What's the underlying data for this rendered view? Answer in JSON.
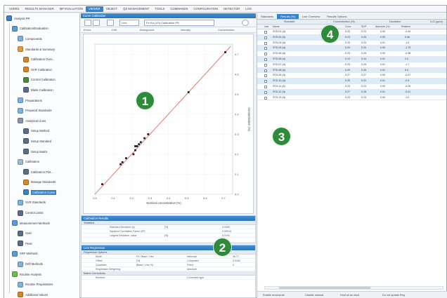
{
  "menu": [
    "USERS",
    "RESULTS MANAGER",
    "MP EVALUATION",
    "VIEWER",
    "OBJECT",
    "QS MANAGEMENT",
    "TOOLS",
    "COMMANDS",
    "CONFIGURATION",
    "DETECTOR",
    "LOG"
  ],
  "tree": [
    {
      "label": "Analysis PR",
      "icon": "#3b82c4",
      "level": 0
    },
    {
      "label": "Calibration/Evaluation",
      "icon": "#5b9bd5",
      "level": 1
    },
    {
      "label": "Components",
      "icon": "#7fb2de",
      "level": 2
    },
    {
      "label": "Standards & Summary",
      "icon": "#e49b3a",
      "level": 2
    },
    {
      "label": "Calibration Over...",
      "icon": "#d4872a",
      "level": 3
    },
    {
      "label": "SVR Calibration",
      "icon": "#d4872a",
      "level": 3
    },
    {
      "label": "Control Calibration",
      "icon": "#4a8b3a",
      "level": 3
    },
    {
      "label": "Blank Calibration",
      "icon": "#5b6d88",
      "level": 3
    },
    {
      "label": "Preparations",
      "icon": "#7fb2de",
      "level": 2
    },
    {
      "label": "Prepared Standards",
      "icon": "#7fb2de",
      "level": 2
    },
    {
      "label": "Analytical Lines",
      "icon": "#8a98ab",
      "level": 2
    },
    {
      "label": "Setup Method",
      "icon": "#5b6d88",
      "level": 3
    },
    {
      "label": "Setup Standard",
      "icon": "#5b6d88",
      "level": 3
    },
    {
      "label": "Setup Matrix",
      "icon": "#5b6d88",
      "level": 3
    },
    {
      "label": "Calibration",
      "icon": "#a3b7cf",
      "level": 2
    },
    {
      "label": "Calibration Plot...",
      "icon": "#5b6d88",
      "level": 3
    },
    {
      "label": "Manage Standards",
      "icon": "#d4872a",
      "level": 3
    },
    {
      "label": "Calibration Curve",
      "icon": "#3b82c4",
      "level": 3,
      "selected": true
    },
    {
      "label": "SVR Standards",
      "icon": "#7fb2de",
      "level": 2
    },
    {
      "label": "Control Limits",
      "icon": "#5b6d88",
      "level": 2
    },
    {
      "label": "Measurement Methods",
      "icon": "#5b9bd5",
      "level": 1
    },
    {
      "label": "Gain",
      "icon": "#5b6d88",
      "level": 2
    },
    {
      "label": "Peak",
      "icon": "#5b6d88",
      "level": 2
    },
    {
      "label": "XRF Methods",
      "icon": "#5b9bd5",
      "level": 1
    },
    {
      "label": "Drift Methods",
      "icon": "#7fb2de",
      "level": 2
    },
    {
      "label": "Routine Analysis",
      "icon": "#6dbd4a",
      "level": 1
    },
    {
      "label": "Routine Preparations",
      "icon": "#7fb2de",
      "level": 2
    },
    {
      "label": "Additional Values",
      "icon": "#d4872a",
      "level": 2
    },
    {
      "label": "Printout",
      "icon": "#5b6d88",
      "level": 2
    }
  ],
  "mid": {
    "panel_title": "Curve Calibration",
    "dropdown1": "Line",
    "dropdown2": "Fe Ka (1/0) Calibration PR",
    "legend": [
      "Errors",
      "Drift",
      "Background",
      "Intensity",
      "Concentration"
    ],
    "calib_header": "Calibration Results",
    "calib_sub": "Statistics",
    "calib_rows": [
      {
        "label": "Standard Deviation (s)",
        "unit": "[%]",
        "value": "0.0065"
      },
      {
        "label": "Squared Correlation Factor (R²)",
        "unit": "",
        "value": "0.99916"
      },
      {
        "label": "Largest Deviation, value",
        "unit": "[%]",
        "value": "0.0194"
      }
    ],
    "line_header": "Line Regression",
    "line_sub": "Regression Options",
    "line_rows": [
      {
        "label": "Mode",
        "c2": "Fit / Base / Use",
        "c3": "Intercept",
        "c4": "36.77"
      },
      {
        "label": "Offset",
        "c2": "[%]",
        "c3": "Computed",
        "c4": "0.0162"
      },
      {
        "label": "Quadratic",
        "c2": "[Base / Uns %]",
        "c3": "Fixed",
        "c4": "0"
      },
      {
        "label": "Regression Weighting",
        "c2": "",
        "c3": "Absolute",
        "c4": ""
      }
    ],
    "matrix_sub": "Matrix Corrections",
    "matrix_rows": [
      {
        "label": "Element",
        "c2": "",
        "c3": "Correction type",
        "c4": ""
      }
    ]
  },
  "right": {
    "tabs": [
      "Standards",
      "Results (%)",
      "Line Overview",
      "Results Options"
    ],
    "active_tab": 1,
    "group_headers": [
      "Standard",
      "Concentration (%)",
      "Deviation",
      "LLD (ppm)"
    ],
    "columns": [
      "Use",
      "Name",
      "",
      "Conc",
      "SDP",
      "Absolute (%)",
      "Relative",
      ""
    ],
    "rows": [
      {
        "name": "STD-01 (A)",
        "c1": "0.23",
        "c2": "0.23",
        "c3": "0.00",
        "c4": "-0.44"
      },
      {
        "name": "STD-02 (A)",
        "c1": "0.23",
        "c2": "0.25",
        "c3": "0.00",
        "c4": "0.46"
      },
      {
        "name": "STD-03 (A)",
        "c1": "0.23",
        "c2": "0.23",
        "c3": "0.01",
        "c4": "-1.5"
      },
      {
        "name": "STD-04 (A)",
        "c1": "0.20",
        "c2": "0.20",
        "c3": "0.00",
        "c4": "-1.75"
      },
      {
        "name": "STD-05 (A)",
        "c1": "0.23",
        "c2": "0.25",
        "c3": "0.00",
        "c4": "-0.38"
      },
      {
        "name": "STD-06 (A)",
        "c1": "0.13",
        "c2": "0.14",
        "c3": "0.01",
        "c4": "2.0"
      },
      {
        "name": "STD-07 (A)",
        "c1": "0.23",
        "c2": "0.25",
        "c3": "0.01",
        "c4": "-1.7"
      },
      {
        "name": "STD-08 (A)",
        "c1": "0.25",
        "c2": "0.25",
        "c3": "0.01",
        "c4": "0.3"
      },
      {
        "name": "STD-09 (A)",
        "c1": "0.27",
        "c2": "0.27",
        "c3": "0.00",
        "c4": "-0.07"
      },
      {
        "name": "STD-10 (A)",
        "c1": "0.25",
        "c2": "0.22",
        "c3": "0.01",
        "c4": "-0.5"
      },
      {
        "name": "STD-11 (A)",
        "c1": "0.23",
        "c2": "0.23",
        "c3": "0.00",
        "c4": "-0.25"
      },
      {
        "name": "STD-12 (A)",
        "c1": "0.27",
        "c2": "0.28",
        "c3": "0.01",
        "c4": "-0.01"
      },
      {
        "name": "STD-13 (A)",
        "c1": "0.23",
        "c2": "0.23",
        "c3": "0.00",
        "c4": "-1.0"
      }
    ],
    "status": [
      "Enable recompute",
      "Disable manual",
      "Hold all as used",
      "Do not update Reg."
    ]
  },
  "chart_data": {
    "type": "scatter",
    "xlabel": "Nominal concentration (%)",
    "ylabel": "Concentration (%)",
    "x_ticks": [
      "0.5",
      "0.1",
      "0.2",
      "0.3",
      "0.4",
      "0.5",
      "0.6",
      "0.7"
    ],
    "y_ticks": [
      "0.7",
      "0.6",
      "0.5",
      "0.4",
      "0.3",
      "0.2",
      "0.1",
      "0.0"
    ],
    "xlim": [
      0,
      0.75
    ],
    "ylim": [
      0,
      0.75
    ],
    "points": [
      {
        "x": 0.04,
        "y": 0.05
      },
      {
        "x": 0.14,
        "y": 0.15
      },
      {
        "x": 0.15,
        "y": 0.16
      },
      {
        "x": 0.17,
        "y": 0.18
      },
      {
        "x": 0.21,
        "y": 0.2
      },
      {
        "x": 0.22,
        "y": 0.22
      },
      {
        "x": 0.22,
        "y": 0.24
      },
      {
        "x": 0.23,
        "y": 0.24
      },
      {
        "x": 0.24,
        "y": 0.25
      },
      {
        "x": 0.25,
        "y": 0.26
      },
      {
        "x": 0.27,
        "y": 0.28
      },
      {
        "x": 0.29,
        "y": 0.3
      },
      {
        "x": 0.51,
        "y": 0.51
      },
      {
        "x": 0.71,
        "y": 0.71
      }
    ],
    "line_color": "#e36a5c",
    "point_color": "#222222"
  },
  "callouts": [
    "1",
    "2",
    "3",
    "4"
  ],
  "colors": {
    "accent": "#3b82c4",
    "callout": "#2e8b3a",
    "selected_row": "#dcebf9"
  }
}
